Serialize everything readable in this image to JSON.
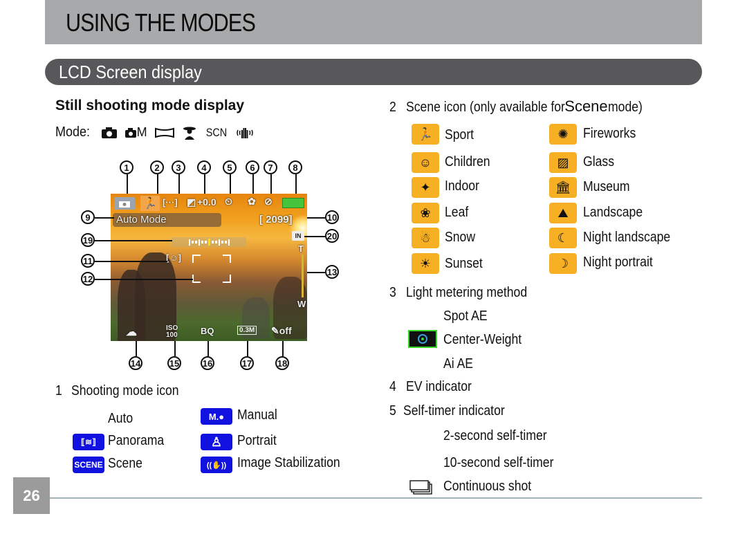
{
  "header": {
    "title": "USING THE MODES"
  },
  "section": {
    "title": "LCD Screen display"
  },
  "left": {
    "heading": "Still shooting mode display",
    "mode_label": "Mode:",
    "mode_icons": [
      "camera-icon",
      "manual-camera-icon",
      "panorama-icon",
      "portrait-icon",
      "scene-text",
      "image-stabilization-icon"
    ],
    "mode_manual_letter": "M",
    "mode_scn": "SCN",
    "lcd": {
      "mode_text": "Auto Mode",
      "ev_value": "+0.0",
      "shots_remaining": "2099",
      "storage": "IN",
      "zoom_t": "T",
      "zoom_w": "W",
      "iso": "ISO 100",
      "quality": "BQ",
      "resolution": "0.3M",
      "off_label": "off"
    },
    "callouts_top": [
      "1",
      "2",
      "3",
      "4",
      "5",
      "6",
      "7",
      "8"
    ],
    "callouts_left": [
      "9",
      "19",
      "11",
      "12"
    ],
    "callouts_right": [
      "10",
      "20",
      "13"
    ],
    "callouts_bottom": [
      "14",
      "15",
      "16",
      "17",
      "18"
    ],
    "item1": {
      "num": "1",
      "title": "Shooting mode icon",
      "modes": [
        {
          "icon": "auto-icon",
          "label": "Auto",
          "badge": ""
        },
        {
          "icon": "manual-icon",
          "label": "Manual",
          "badge": "M.●"
        },
        {
          "icon": "panorama-icon",
          "label": "Panorama",
          "badge": "⟦≋⟧"
        },
        {
          "icon": "portrait-icon",
          "label": "Portrait",
          "badge": "♙"
        },
        {
          "icon": "scene-icon",
          "label": "Scene",
          "badge": "SCENE"
        },
        {
          "icon": "image-stabilization-icon",
          "label": "Image Stabilization",
          "badge": "((✋))"
        }
      ]
    }
  },
  "right": {
    "item2": {
      "num": "2",
      "title_pre": "Scene icon (only available for ",
      "title_bold": "Scene",
      "title_post": " mode)",
      "scenes_left": [
        {
          "icon": "sport-icon",
          "glyph": "🏃",
          "label": "Sport"
        },
        {
          "icon": "children-icon",
          "glyph": "☺",
          "label": "Children"
        },
        {
          "icon": "indoor-icon",
          "glyph": "✦",
          "label": "Indoor"
        },
        {
          "icon": "leaf-icon",
          "glyph": "❀",
          "label": "Leaf"
        },
        {
          "icon": "snow-icon",
          "glyph": "☃",
          "label": "Snow"
        },
        {
          "icon": "sunset-icon",
          "glyph": "☀",
          "label": "Sunset"
        }
      ],
      "scenes_right": [
        {
          "icon": "fireworks-icon",
          "glyph": "✺",
          "label": "Fireworks"
        },
        {
          "icon": "glass-icon",
          "glyph": "▨",
          "label": "Glass"
        },
        {
          "icon": "museum-icon",
          "glyph": "🏛",
          "label": "Museum"
        },
        {
          "icon": "landscape-icon",
          "glyph": "⛰",
          "label": "Landscape"
        },
        {
          "icon": "night-landscape-icon",
          "glyph": "☾",
          "label": "Night landscape"
        },
        {
          "icon": "night-portrait-icon",
          "glyph": "☽",
          "label": "Night portrait"
        }
      ]
    },
    "item3": {
      "num": "3",
      "title": "Light metering method",
      "options": [
        "Spot AE",
        "Center-Weight",
        "Ai AE"
      ]
    },
    "item4": {
      "num": "4",
      "title": "EV indicator"
    },
    "item5": {
      "num": "5",
      "title": "Self-timer indicator",
      "options": [
        "2-second self-timer",
        "10-second self-timer",
        "Continuous shot"
      ]
    }
  },
  "footer": {
    "page_number": "26"
  },
  "colors": {
    "scene_icon_bg": "#f7b023",
    "mode_icon_bg": "#1212e0",
    "header_bg": "#a8a9ab",
    "section_bg": "#58585b"
  }
}
